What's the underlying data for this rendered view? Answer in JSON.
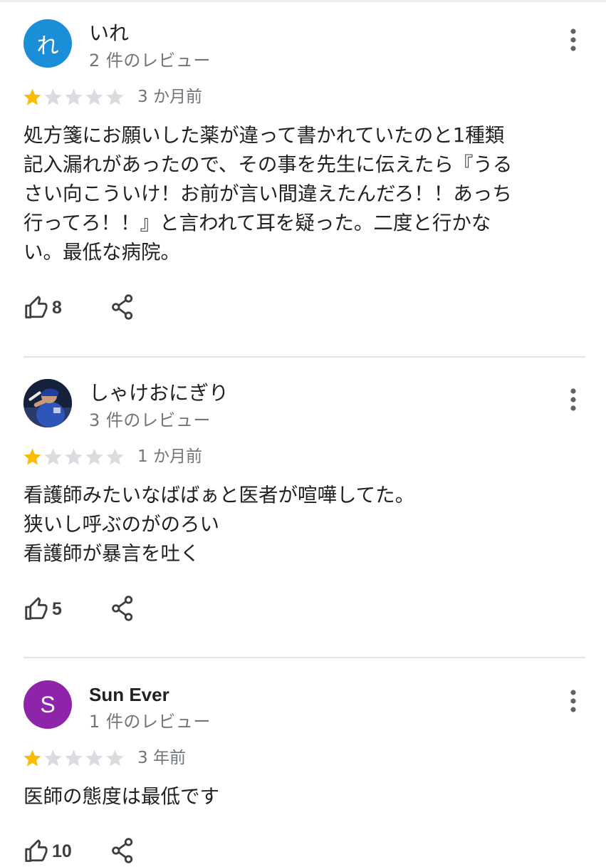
{
  "reviews": [
    {
      "avatar_letter": "れ",
      "avatar_color": "#1a8fd8",
      "avatar_type": "letter",
      "name": "いれ",
      "review_count": "2 件のレビュー",
      "rating": 1,
      "date": "3 か月前",
      "text": [
        "処方箋にお願いした薬が違って書かれていたのと1種類",
        "記入漏れがあったので、その事を先生に伝えたら『うる",
        "さい向こういけ！お前が言い間違えたんだろ！！あっち",
        "行ってろ！！』と言われて耳を疑った。二度と行かな",
        "い。最低な病院。"
      ],
      "likes": "8"
    },
    {
      "avatar_letter": "",
      "avatar_color": "#1b2a4a",
      "avatar_type": "photo",
      "name": "しゃけおにぎり",
      "review_count": "3 件のレビュー",
      "rating": 1,
      "date": "1 か月前",
      "text": [
        "看護師みたいなばばぁと医者が喧嘩してた。",
        "狭いし呼ぶのがのろい",
        "看護師が暴言を吐く"
      ],
      "likes": "5"
    },
    {
      "avatar_letter": "S",
      "avatar_color": "#8e24aa",
      "avatar_type": "letter",
      "name": "Sun Ever",
      "review_count": "1 件のレビュー",
      "rating": 1,
      "date": "3 年前",
      "text": [
        "医師の態度は最低です"
      ],
      "likes": "10"
    }
  ],
  "colors": {
    "star_filled": "#fbbc04",
    "star_empty": "#dadce0",
    "secondary_text": "#70757a",
    "icon": "#3c4043"
  },
  "icons": {
    "more": "more-vert-icon",
    "like": "thumb-up-icon",
    "share": "share-icon",
    "star": "star-icon"
  }
}
